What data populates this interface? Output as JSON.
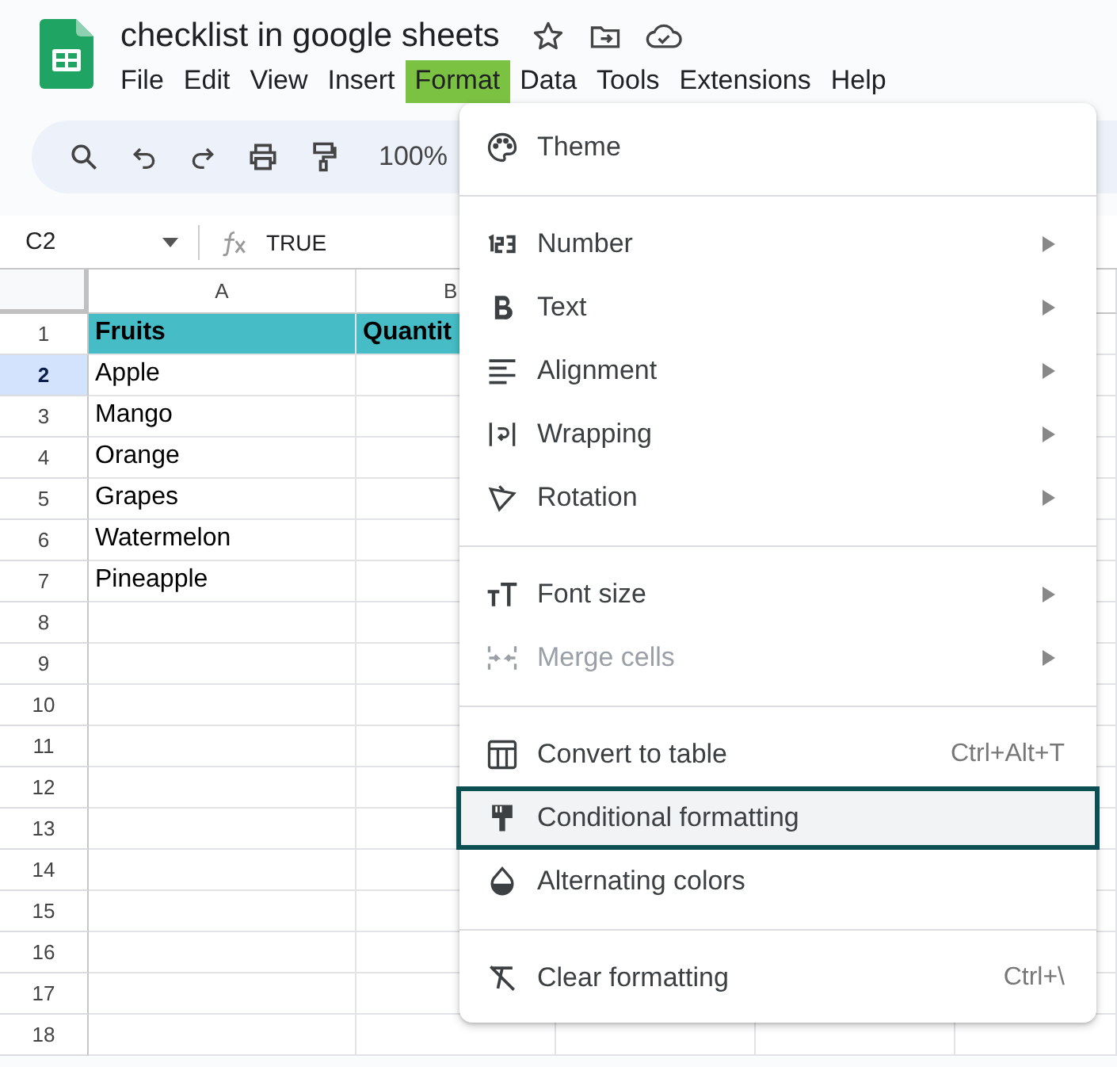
{
  "document": {
    "title": "checklist in google sheets"
  },
  "menu_bar": [
    {
      "label": "File",
      "selected": false
    },
    {
      "label": "Edit",
      "selected": false
    },
    {
      "label": "View",
      "selected": false
    },
    {
      "label": "Insert",
      "selected": false
    },
    {
      "label": "Format",
      "selected": true
    },
    {
      "label": "Data",
      "selected": false
    },
    {
      "label": "Tools",
      "selected": false
    },
    {
      "label": "Extensions",
      "selected": false
    },
    {
      "label": "Help",
      "selected": false
    }
  ],
  "toolbar": {
    "zoom": "100%"
  },
  "formula_bar": {
    "cell_reference": "C2",
    "formula": "TRUE"
  },
  "sheet": {
    "columns": [
      "A",
      "B"
    ],
    "rows": [
      {
        "number": "1",
        "selected": false,
        "kind": "header",
        "cells": [
          "Fruits",
          "Quantit"
        ]
      },
      {
        "number": "2",
        "selected": true,
        "kind": "data",
        "cells": [
          "Apple"
        ]
      },
      {
        "number": "3",
        "selected": false,
        "kind": "data",
        "cells": [
          "Mango"
        ]
      },
      {
        "number": "4",
        "selected": false,
        "kind": "data",
        "cells": [
          "Orange"
        ]
      },
      {
        "number": "5",
        "selected": false,
        "kind": "data",
        "cells": [
          "Grapes"
        ]
      },
      {
        "number": "6",
        "selected": false,
        "kind": "data",
        "cells": [
          "Watermelon"
        ]
      },
      {
        "number": "7",
        "selected": false,
        "kind": "data",
        "cells": [
          "Pineapple"
        ]
      },
      {
        "number": "8",
        "selected": false,
        "kind": "data",
        "cells": []
      },
      {
        "number": "9",
        "selected": false,
        "kind": "data",
        "cells": []
      },
      {
        "number": "10",
        "selected": false,
        "kind": "data",
        "cells": []
      },
      {
        "number": "11",
        "selected": false,
        "kind": "data",
        "cells": []
      },
      {
        "number": "12",
        "selected": false,
        "kind": "data",
        "cells": []
      },
      {
        "number": "13",
        "selected": false,
        "kind": "data",
        "cells": []
      },
      {
        "number": "14",
        "selected": false,
        "kind": "data",
        "cells": []
      },
      {
        "number": "15",
        "selected": false,
        "kind": "data",
        "cells": []
      },
      {
        "number": "16",
        "selected": false,
        "kind": "data",
        "cells": []
      },
      {
        "number": "17",
        "selected": false,
        "kind": "data",
        "cells": []
      },
      {
        "number": "18",
        "selected": false,
        "kind": "data",
        "cells": []
      }
    ]
  },
  "format_menu": {
    "groups": [
      [
        {
          "label": "Theme",
          "submenu": false,
          "disabled": false,
          "selected": false
        }
      ],
      [
        {
          "label": "Number",
          "submenu": true,
          "disabled": false,
          "selected": false
        },
        {
          "label": "Text",
          "submenu": true,
          "disabled": false,
          "selected": false
        },
        {
          "label": "Alignment",
          "submenu": true,
          "disabled": false,
          "selected": false
        },
        {
          "label": "Wrapping",
          "submenu": true,
          "disabled": false,
          "selected": false
        },
        {
          "label": "Rotation",
          "submenu": true,
          "disabled": false,
          "selected": false
        }
      ],
      [
        {
          "label": "Font size",
          "submenu": true,
          "disabled": false,
          "selected": false
        },
        {
          "label": "Merge cells",
          "submenu": true,
          "disabled": true,
          "selected": false
        }
      ],
      [
        {
          "label": "Convert to table",
          "shortcut": "Ctrl+Alt+T",
          "submenu": false,
          "disabled": false,
          "selected": false
        },
        {
          "label": "Conditional formatting",
          "submenu": false,
          "disabled": false,
          "selected": true
        },
        {
          "label": "Alternating colors",
          "submenu": false,
          "disabled": false,
          "selected": false
        }
      ],
      [
        {
          "label": "Clear formatting",
          "shortcut": "Ctrl+\\",
          "submenu": false,
          "disabled": false,
          "selected": false
        }
      ]
    ]
  }
}
